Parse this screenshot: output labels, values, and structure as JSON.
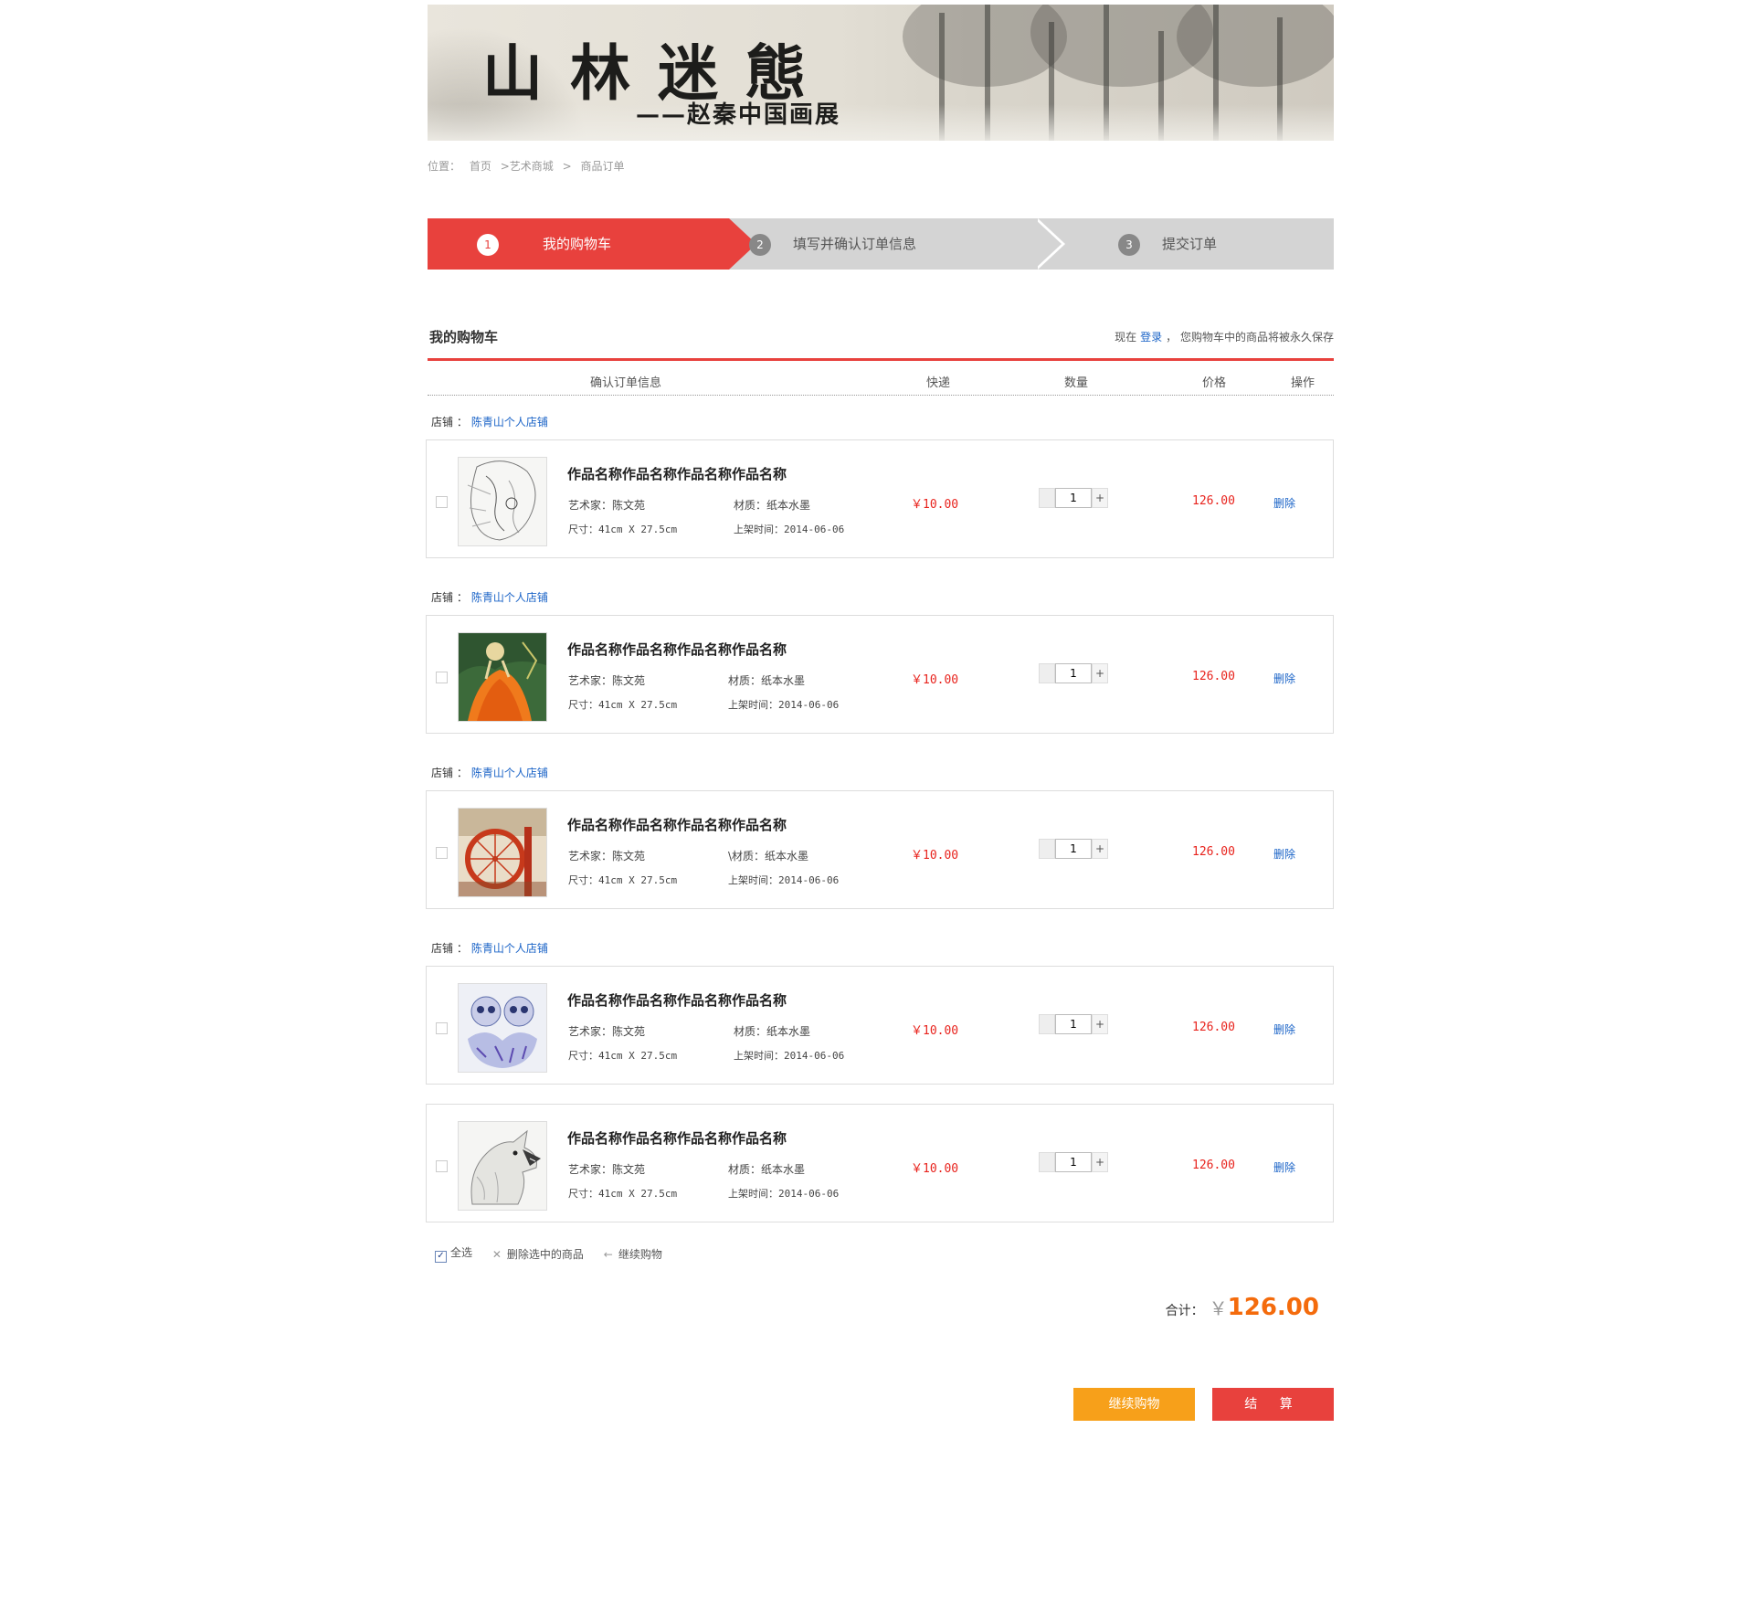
{
  "banner": {
    "title": "山林迷態",
    "subtitle": "——赵秦中国画展"
  },
  "breadcrumb": {
    "items": [
      "位置：",
      "首页",
      ">艺术商城",
      ">",
      "商品订单"
    ]
  },
  "steps": [
    {
      "num": "1",
      "label": "我的购物车"
    },
    {
      "num": "2",
      "label": "填写并确认订单信息"
    },
    {
      "num": "3",
      "label": "提交订单"
    }
  ],
  "cart": {
    "title": "我的购物车",
    "notice_prefix": "现在",
    "notice_link": "登录",
    "notice_suffix": "，  您购物车中的商品将被永久保存"
  },
  "columns": {
    "info": "确认订单信息",
    "ship": "快递",
    "qty": "数量",
    "price": "价格",
    "op": "操作"
  },
  "shops": [
    {
      "label": "店铺 ：",
      "name": "陈青山个人店铺"
    },
    {
      "label": "店铺 ：",
      "name": "陈青山个人店铺"
    },
    {
      "label": "店铺 ：",
      "name": "陈青山个人店铺"
    },
    {
      "label": "店铺 ：",
      "name": "陈青山个人店铺"
    }
  ],
  "items": [
    {
      "name": "作品名称作品名称作品名称作品名称",
      "artist": "艺术家：陈文苑",
      "material": "材质：纸本水墨",
      "size": "尺寸：41cm X 27.5cm",
      "date": "上架时间：2014-06-06",
      "shipping": "￥10.00",
      "qty": "1",
      "price": "126.00",
      "delete": "删除"
    },
    {
      "name": "作品名称作品名称作品名称作品名称",
      "artist": "艺术家：陈文苑",
      "material": "材质：纸本水墨",
      "size": "尺寸：41cm X 27.5cm",
      "date": "上架时间：2014-06-06",
      "shipping": "￥10.00",
      "qty": "1",
      "price": "126.00",
      "delete": "删除"
    },
    {
      "name": "作品名称作品名称作品名称作品名称",
      "artist": "艺术家：陈文苑",
      "material": "\\材质：纸本水墨",
      "size": "尺寸：41cm X 27.5cm",
      "date": "上架时间：2014-06-06",
      "shipping": "￥10.00",
      "qty": "1",
      "price": "126.00",
      "delete": "删除"
    },
    {
      "name": "作品名称作品名称作品名称作品名称",
      "artist": "艺术家：陈文苑",
      "material": "材质：纸本水墨",
      "size": "尺寸：41cm X 27.5cm",
      "date": "上架时间：2014-06-06",
      "shipping": "￥10.00",
      "qty": "1",
      "price": "126.00",
      "delete": "删除"
    },
    {
      "name": "作品名称作品名称作品名称作品名称",
      "artist": "艺术家：陈文苑",
      "material": "材质：纸本水墨",
      "size": "尺寸：41cm X 27.5cm",
      "date": "上架时间：2014-06-06",
      "shipping": "￥10.00",
      "qty": "1",
      "price": "126.00",
      "delete": "删除"
    }
  ],
  "bottom": {
    "select_all": "全选",
    "delete_selected": "删除选中的商品",
    "continue_link": "继续购物",
    "total_label": "合计：",
    "total_currency": "￥",
    "total_amount": "126.00",
    "continue_button": "继续购物",
    "checkout_button": "结 算"
  },
  "colors": {
    "accent": "#e8413d",
    "price": "#e8231d",
    "link": "#1a63c7",
    "total": "#f46b0c",
    "continue_btn": "#f7a01a"
  }
}
